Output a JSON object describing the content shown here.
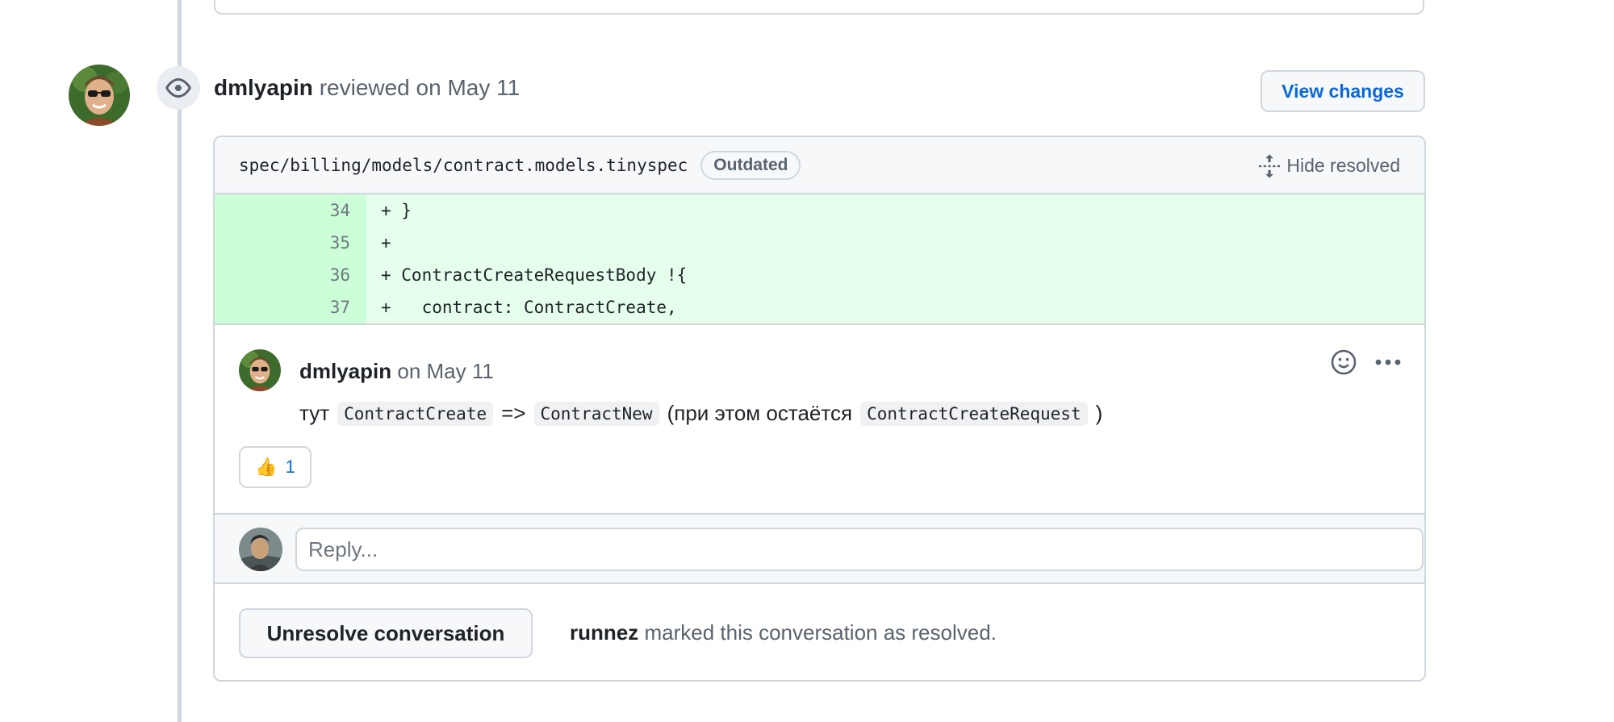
{
  "review": {
    "author": "dmlyapin",
    "action": "reviewed",
    "date": "on May 11",
    "view_changes_label": "View changes"
  },
  "file": {
    "path": "spec/billing/models/contract.models.tinyspec",
    "badge": "Outdated",
    "hide_resolved_label": "Hide resolved"
  },
  "diff": {
    "lines": [
      {
        "num": "34",
        "code": "+ }"
      },
      {
        "num": "35",
        "code": "+"
      },
      {
        "num": "36",
        "code": "+ ContractCreateRequestBody !{"
      },
      {
        "num": "37",
        "code": "+   contract: ContractCreate,"
      }
    ]
  },
  "comment": {
    "author": "dmlyapin",
    "date": "on May 11",
    "body": {
      "t1": "тут",
      "c1": "ContractCreate",
      "t2": "=>",
      "c2": "ContractNew",
      "t3": "(при этом остаётся",
      "c3": "ContractCreateRequest",
      "t4": ")"
    },
    "reaction": {
      "emoji": "👍",
      "count": "1"
    }
  },
  "reply": {
    "placeholder": "Reply..."
  },
  "resolution": {
    "button_label": "Unresolve conversation",
    "user": "runnez",
    "text": "marked this conversation as resolved."
  },
  "colors": {
    "link": "#0969da",
    "diff_add_bg": "#e6ffec",
    "diff_add_num_bg": "#ccffd8",
    "border": "#d0d7de"
  },
  "icons": [
    "eye-icon",
    "unfold-icon",
    "smiley-icon",
    "kebab-horizontal-icon"
  ]
}
